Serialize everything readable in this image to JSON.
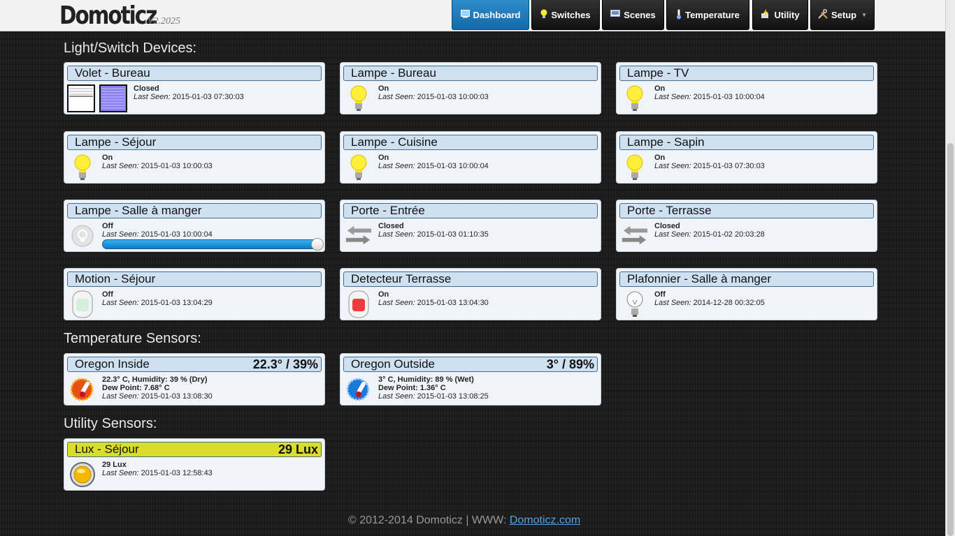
{
  "app": {
    "name": "Domoticz",
    "version": "V2.2025"
  },
  "nav": [
    {
      "label": "Dashboard",
      "icon": "dashboard-icon",
      "active": true
    },
    {
      "label": "Switches",
      "icon": "bulb-icon",
      "active": false
    },
    {
      "label": "Scenes",
      "icon": "scenes-icon",
      "active": false
    },
    {
      "label": "Temperature",
      "icon": "thermometer-icon",
      "active": false
    },
    {
      "label": "Utility",
      "icon": "utility-icon",
      "active": false
    },
    {
      "label": "Setup",
      "icon": "tools-icon",
      "active": false
    }
  ],
  "sections": {
    "light": "Light/Switch Devices:",
    "temperature": "Temperature Sensors:",
    "utility": "Utility Sensors:"
  },
  "seen_label": "Last Seen:",
  "switches": [
    {
      "name": "Volet - Bureau",
      "status": "Closed",
      "last_seen": "2015-01-03 07:30:03",
      "icon": "blinds-icon"
    },
    {
      "name": "Lampe - Bureau",
      "status": "On",
      "last_seen": "2015-01-03 10:00:03",
      "icon": "bulb-on-icon"
    },
    {
      "name": "Lampe - TV",
      "status": "On",
      "last_seen": "2015-01-03 10:00:04",
      "icon": "bulb-on-icon"
    },
    {
      "name": "Lampe - Séjour",
      "status": "On",
      "last_seen": "2015-01-03 10:00:03",
      "icon": "bulb-on-icon"
    },
    {
      "name": "Lampe - Cuisine",
      "status": "On",
      "last_seen": "2015-01-03 10:00:04",
      "icon": "bulb-on-icon"
    },
    {
      "name": "Lampe - Sapin",
      "status": "On",
      "last_seen": "2015-01-03 07:30:03",
      "icon": "bulb-on-icon"
    },
    {
      "name": "Lampe - Salle à manger",
      "status": "Off",
      "last_seen": "2015-01-03 10:00:04",
      "icon": "dimmer-off-icon",
      "dimmer_level": 1.0
    },
    {
      "name": "Porte - Entrée",
      "status": "Closed",
      "last_seen": "2015-01-03 01:10:35",
      "icon": "door-arrows-icon"
    },
    {
      "name": "Porte - Terrasse",
      "status": "Closed",
      "last_seen": "2015-01-02 20:03:28",
      "icon": "door-arrows-icon"
    },
    {
      "name": "Motion - Séjour",
      "status": "Off",
      "last_seen": "2015-01-03 13:04:29",
      "icon": "motion-off-icon"
    },
    {
      "name": "Detecteur Terrasse",
      "status": "On",
      "last_seen": "2015-01-03 13:04:30",
      "icon": "motion-on-icon"
    },
    {
      "name": "Plafonnier - Salle à manger",
      "status": "Off",
      "last_seen": "2014-12-28 00:32:05",
      "icon": "bulb-off-icon"
    }
  ],
  "temperature": [
    {
      "name": "Oregon Inside",
      "value": "22.3° / 39%",
      "line1": "22.3° C, Humidity: 39 % (Dry)",
      "line2": "Dew Point: 7.68° C",
      "last_seen": "2015-01-03 13:08:30",
      "icon": "thermometer-warm-icon",
      "color": "#e8501a"
    },
    {
      "name": "Oregon Outside",
      "value": "3° / 89%",
      "line1": "3° C, Humidity: 89 % (Wet)",
      "line2": "Dew Point: 1.36° C",
      "last_seen": "2015-01-03 13:08:25",
      "icon": "thermometer-cold-icon",
      "color": "#1a7ad8"
    }
  ],
  "utility": [
    {
      "name": "Lux - Séjour",
      "value": "29 Lux",
      "detail": "29 Lux",
      "last_seen": "2015-01-03 12:58:43",
      "icon": "lux-icon"
    }
  ],
  "footer": {
    "text": "© 2012-2014 Domoticz | WWW: ",
    "link": "Domoticz.com"
  },
  "colors": {
    "accent": "#1a78b8",
    "title_bar": "#cfe0f1",
    "utility_title": "#dcdc2a"
  }
}
